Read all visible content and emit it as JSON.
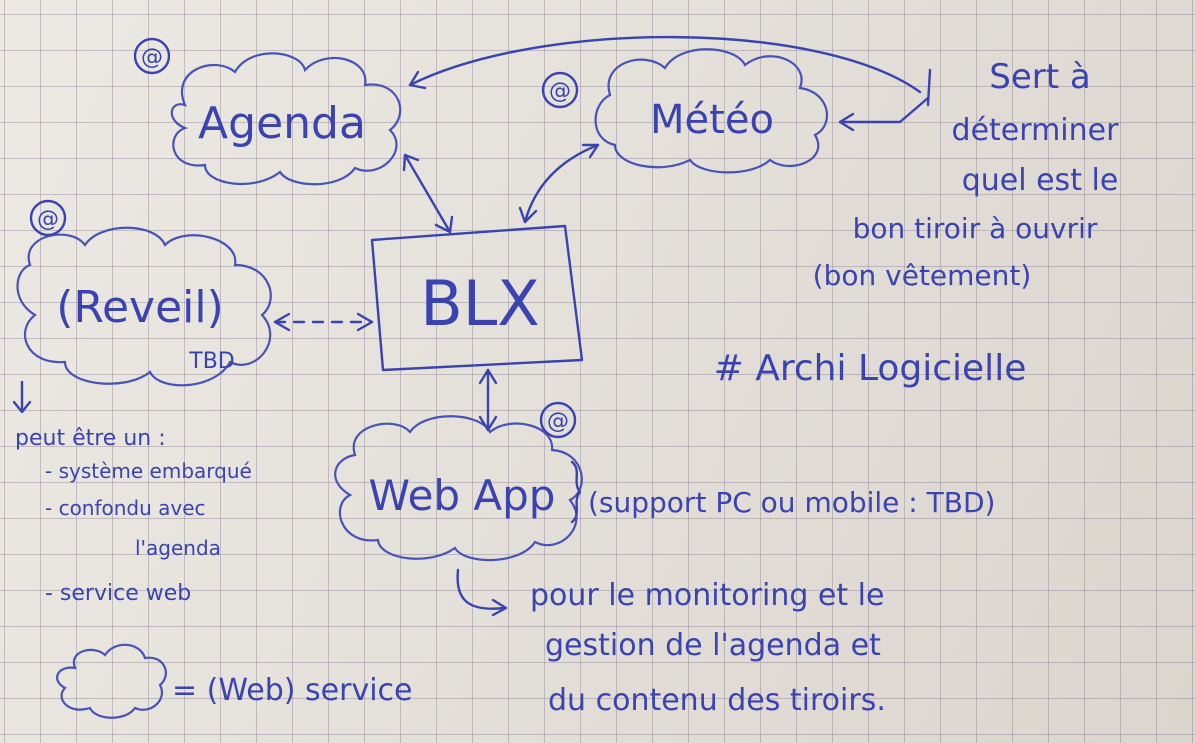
{
  "ink_color": "#3a43b0",
  "paper_color": "#e6e2db",
  "nodes": {
    "agenda": "Agenda",
    "meteo": "Météo",
    "reveil": "(Reveil)",
    "reveil_sub": "TBD",
    "blx": "BLX",
    "webapp": "Web App"
  },
  "markers": {
    "a": "@"
  },
  "notes": {
    "meteo_1": "Sert à",
    "meteo_2": "déterminer",
    "meteo_3": "quel est le",
    "meteo_4": "bon tiroir à ouvrir",
    "meteo_5": "(bon vêtement)",
    "title": "# Archi Logicielle",
    "reveil_1": "peut être un :",
    "reveil_2": "- système embarqué",
    "reveil_3": "- confondu avec",
    "reveil_4": "l'agenda",
    "reveil_5": "- service web",
    "webapp_support": "(support PC ou mobile : TBD)",
    "webapp_1": "pour le monitoring et le",
    "webapp_2": "gestion de l'agenda et",
    "webapp_3": "du contenu des tiroirs.",
    "legend": "= (Web) service"
  }
}
